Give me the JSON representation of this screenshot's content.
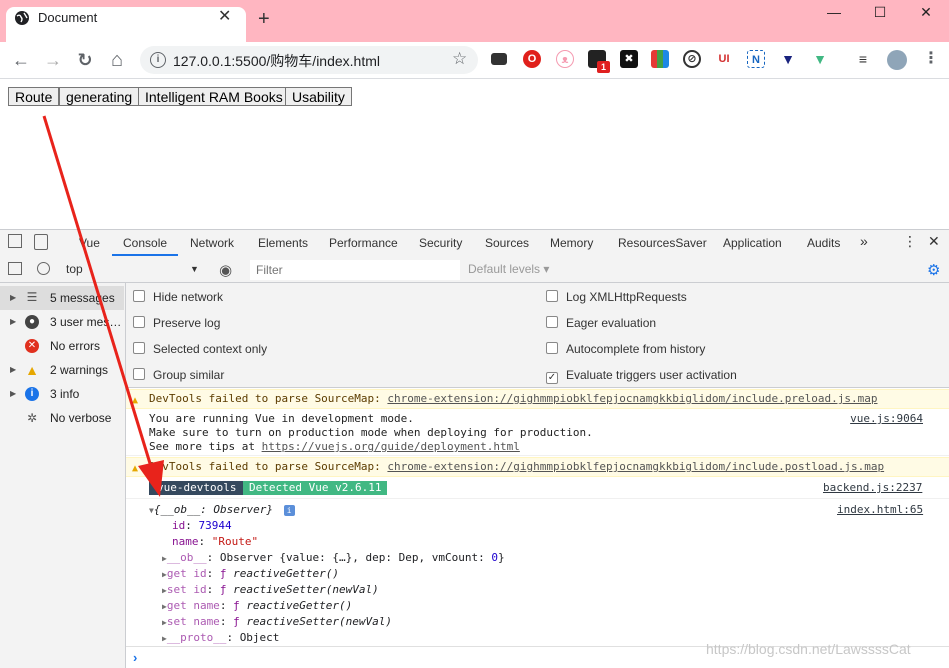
{
  "browser": {
    "tab_title": "Document",
    "tab_close": "✕",
    "new_tab": "+",
    "window_controls": {
      "minimize": "—",
      "maximize": "☐",
      "close": "✕"
    },
    "nav": {
      "back": "←",
      "forward": "→",
      "reload": "↻",
      "home": "⌂"
    },
    "url": "127.0.0.1:5500/购物车/index.html",
    "extension_badge_count": "1",
    "extensions": [
      "laptop-icon",
      "opera-icon",
      "cat-icon",
      "notifications-icon",
      "dark-icon",
      "color-icon",
      "grammarly-icon",
      "ui-icon",
      "n-icon",
      "vue-devtools-icon",
      "vue-icon",
      "playlist-icon",
      "avatar",
      "menu-icon"
    ]
  },
  "page": {
    "buttons": [
      "Route",
      "generating",
      "Intelligent RAM Books",
      "Usability"
    ]
  },
  "devtools": {
    "tabs": [
      "Vue",
      "Console",
      "Network",
      "Elements",
      "Performance",
      "Security",
      "Sources",
      "Memory",
      "ResourcesSaver",
      "Application",
      "Audits"
    ],
    "active_tab": "Console",
    "more_tabs": "»",
    "context": "top",
    "filter_placeholder": "Filter",
    "levels": "Default levels ▾",
    "sidebar": [
      {
        "label": "5 messages",
        "icon": "list-icon"
      },
      {
        "label": "3 user mes…",
        "icon": "user-icon"
      },
      {
        "label": "No errors",
        "icon": "error-icon"
      },
      {
        "label": "2 warnings",
        "icon": "warning-icon"
      },
      {
        "label": "3 info",
        "icon": "info-icon"
      },
      {
        "label": "No verbose",
        "icon": "verbose-icon"
      }
    ],
    "settings_left": [
      "Hide network",
      "Preserve log",
      "Selected context only",
      "Group similar"
    ],
    "settings_right": [
      "Log XMLHttpRequests",
      "Eager evaluation",
      "Autocomplete from history",
      "Evaluate triggers user activation"
    ],
    "settings_right_checked": [
      false,
      false,
      false,
      true
    ],
    "console": {
      "warn1_text": "DevTools failed to parse SourceMap: ",
      "warn1_link": "chrome-extension://gighmmpiobklfepjocnamgkkbiglidom/include.preload.js.map",
      "info_line1": "You are running Vue in development mode.",
      "info_line2": "Make sure to turn on production mode when deploying for production.",
      "info_line3_prefix": "See more tips at ",
      "info_line3_link": "https://vuejs.org/guide/deployment.html",
      "info_source": "vue.js:9064",
      "warn2_text": "DevTools failed to parse SourceMap: ",
      "warn2_link": "chrome-extension://gighmmpiobklfepjocnamgkkbiglidom/include.postload.js.map",
      "badge_left": "vue-devtools",
      "badge_right": "Detected Vue v2.6.11",
      "badge_source": "backend.js:2237",
      "obj_header": "{__ob__: Observer}",
      "obj_source": "index.html:65",
      "id_key": "id",
      "id_val": "73944",
      "name_key": "name",
      "name_val": "\"Route\"",
      "ob_key": "__ob__",
      "ob_val": "Observer {value: {…}, dep: Dep, vmCount: ",
      "ob_count": "0",
      "ob_close": "}",
      "getid_key": "get id",
      "getid_val": "reactiveGetter()",
      "setid_key": "set id",
      "setid_val": "reactiveSetter(newVal)",
      "getname_key": "get name",
      "getname_val": "reactiveGetter()",
      "setname_key": "set name",
      "setname_val": "reactiveSetter(newVal)",
      "proto_key": "__proto__",
      "proto_val": "Object",
      "f_glyph": "ƒ",
      "prompt": "›"
    }
  },
  "annotation": {
    "arrow_color": "#e8231b"
  },
  "watermark": "https://blog.csdn.net/LawssssCat"
}
